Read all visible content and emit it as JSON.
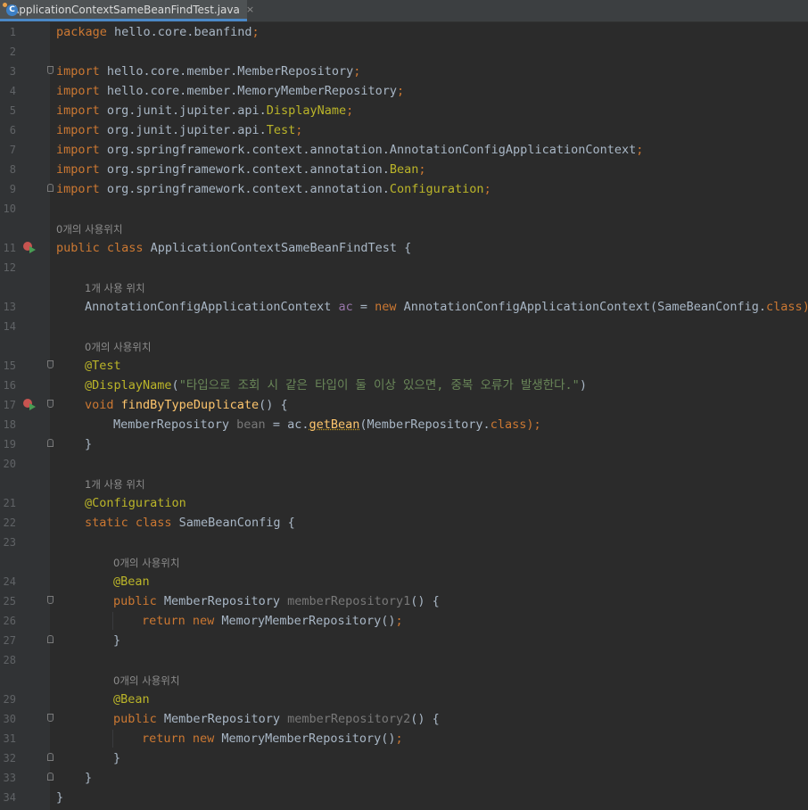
{
  "tab": {
    "title": "ApplicationContextSameBeanFindTest.java",
    "close": "×",
    "icon": "java-class-icon"
  },
  "lines": {
    "l1": {
      "num": "1",
      "t1": "package",
      "t2": " hello.core.beanfind",
      "t3": ";"
    },
    "l2": {
      "num": "2"
    },
    "l3": {
      "num": "3",
      "t1": "import",
      "t2": " hello.core.member.MemberRepository",
      "t3": ";"
    },
    "l4": {
      "num": "4",
      "t1": "import",
      "t2": " hello.core.member.MemoryMemberRepository",
      "t3": ";"
    },
    "l5": {
      "num": "5",
      "t1": "import",
      "t2": " org.junit.jupiter.api.",
      "t3": "DisplayName",
      "t4": ";"
    },
    "l6": {
      "num": "6",
      "t1": "import",
      "t2": " org.junit.jupiter.api.",
      "t3": "Test",
      "t4": ";"
    },
    "l7": {
      "num": "7",
      "t1": "import",
      "t2": " org.springframework.context.annotation.AnnotationConfigApplicationContext",
      "t3": ";"
    },
    "l8": {
      "num": "8",
      "t1": "import",
      "t2": " org.springframework.context.annotation.",
      "t3": "Bean",
      "t4": ";"
    },
    "l9": {
      "num": "9",
      "t1": "import",
      "t2": " org.springframework.context.annotation.",
      "t3": "Configuration",
      "t4": ";"
    },
    "l10": {
      "num": "10"
    },
    "l11": {
      "num": "11",
      "t1": "public class",
      "t2": " ApplicationContextSameBeanFindTest {"
    },
    "l12": {
      "num": "12"
    },
    "l13": {
      "num": "13",
      "t1": "AnnotationConfigApplicationContext ",
      "t2": "ac",
      "t3": " = ",
      "t4": "new",
      "t5": " AnnotationConfigApplicationContext(SameBeanConfig.",
      "t6": "class",
      "t7": ");"
    },
    "l14": {
      "num": "14"
    },
    "l15": {
      "num": "15",
      "t1": "@Test"
    },
    "l16": {
      "num": "16",
      "t1": "@DisplayName",
      "t2": "(",
      "t3": "\"타입으로 조회 시 같은 타입이 둘 이상 있으면, 중복 오류가 발생한다.\"",
      "t4": ")"
    },
    "l17": {
      "num": "17",
      "t1": "void",
      "t2": " ",
      "t3": "findByTypeDuplicate",
      "t4": "() {"
    },
    "l18": {
      "num": "18",
      "t1": "MemberRepository ",
      "t2": "bean",
      "t3": " = ac.",
      "t4": "getBean",
      "t5": "(MemberRepository.",
      "t6": "class",
      "t7": ");"
    },
    "l19": {
      "num": "19",
      "t1": "}"
    },
    "l20": {
      "num": "20"
    },
    "l21": {
      "num": "21",
      "t1": "@Configuration"
    },
    "l22": {
      "num": "22",
      "t1": "static class",
      "t2": " SameBeanConfig {"
    },
    "l23": {
      "num": "23"
    },
    "l24": {
      "num": "24",
      "t1": "@Bean"
    },
    "l25": {
      "num": "25",
      "t1": "public",
      "t2": " MemberRepository ",
      "t3": "memberRepository1",
      "t4": "() {"
    },
    "l26": {
      "num": "26",
      "t1": "return new",
      "t2": " MemoryMemberRepository()",
      "t3": ";"
    },
    "l27": {
      "num": "27",
      "t1": "}"
    },
    "l28": {
      "num": "28"
    },
    "l29": {
      "num": "29",
      "t1": "@Bean"
    },
    "l30": {
      "num": "30",
      "t1": "public",
      "t2": " MemberRepository ",
      "t3": "memberRepository2",
      "t4": "() {"
    },
    "l31": {
      "num": "31",
      "t1": "return new",
      "t2": " MemoryMemberRepository()",
      "t3": ";"
    },
    "l32": {
      "num": "32",
      "t1": "}"
    },
    "l33": {
      "num": "33",
      "t1": "}"
    },
    "l34": {
      "num": "34",
      "t1": "}"
    }
  },
  "hints": {
    "h11": "0개의 사용위치",
    "h13": "1개 사용 위치",
    "h15": "0개의 사용위치",
    "h21": "1개 사용 위치",
    "h24": "0개의 사용위치",
    "h29": "0개의 사용위치"
  },
  "colors": {
    "keyword": "#cc7832",
    "annotation": "#bbb529",
    "string": "#6a8759",
    "method": "#ffc66d",
    "field": "#9876aa",
    "text": "#a9b7c6",
    "background": "#2b2b2b"
  }
}
